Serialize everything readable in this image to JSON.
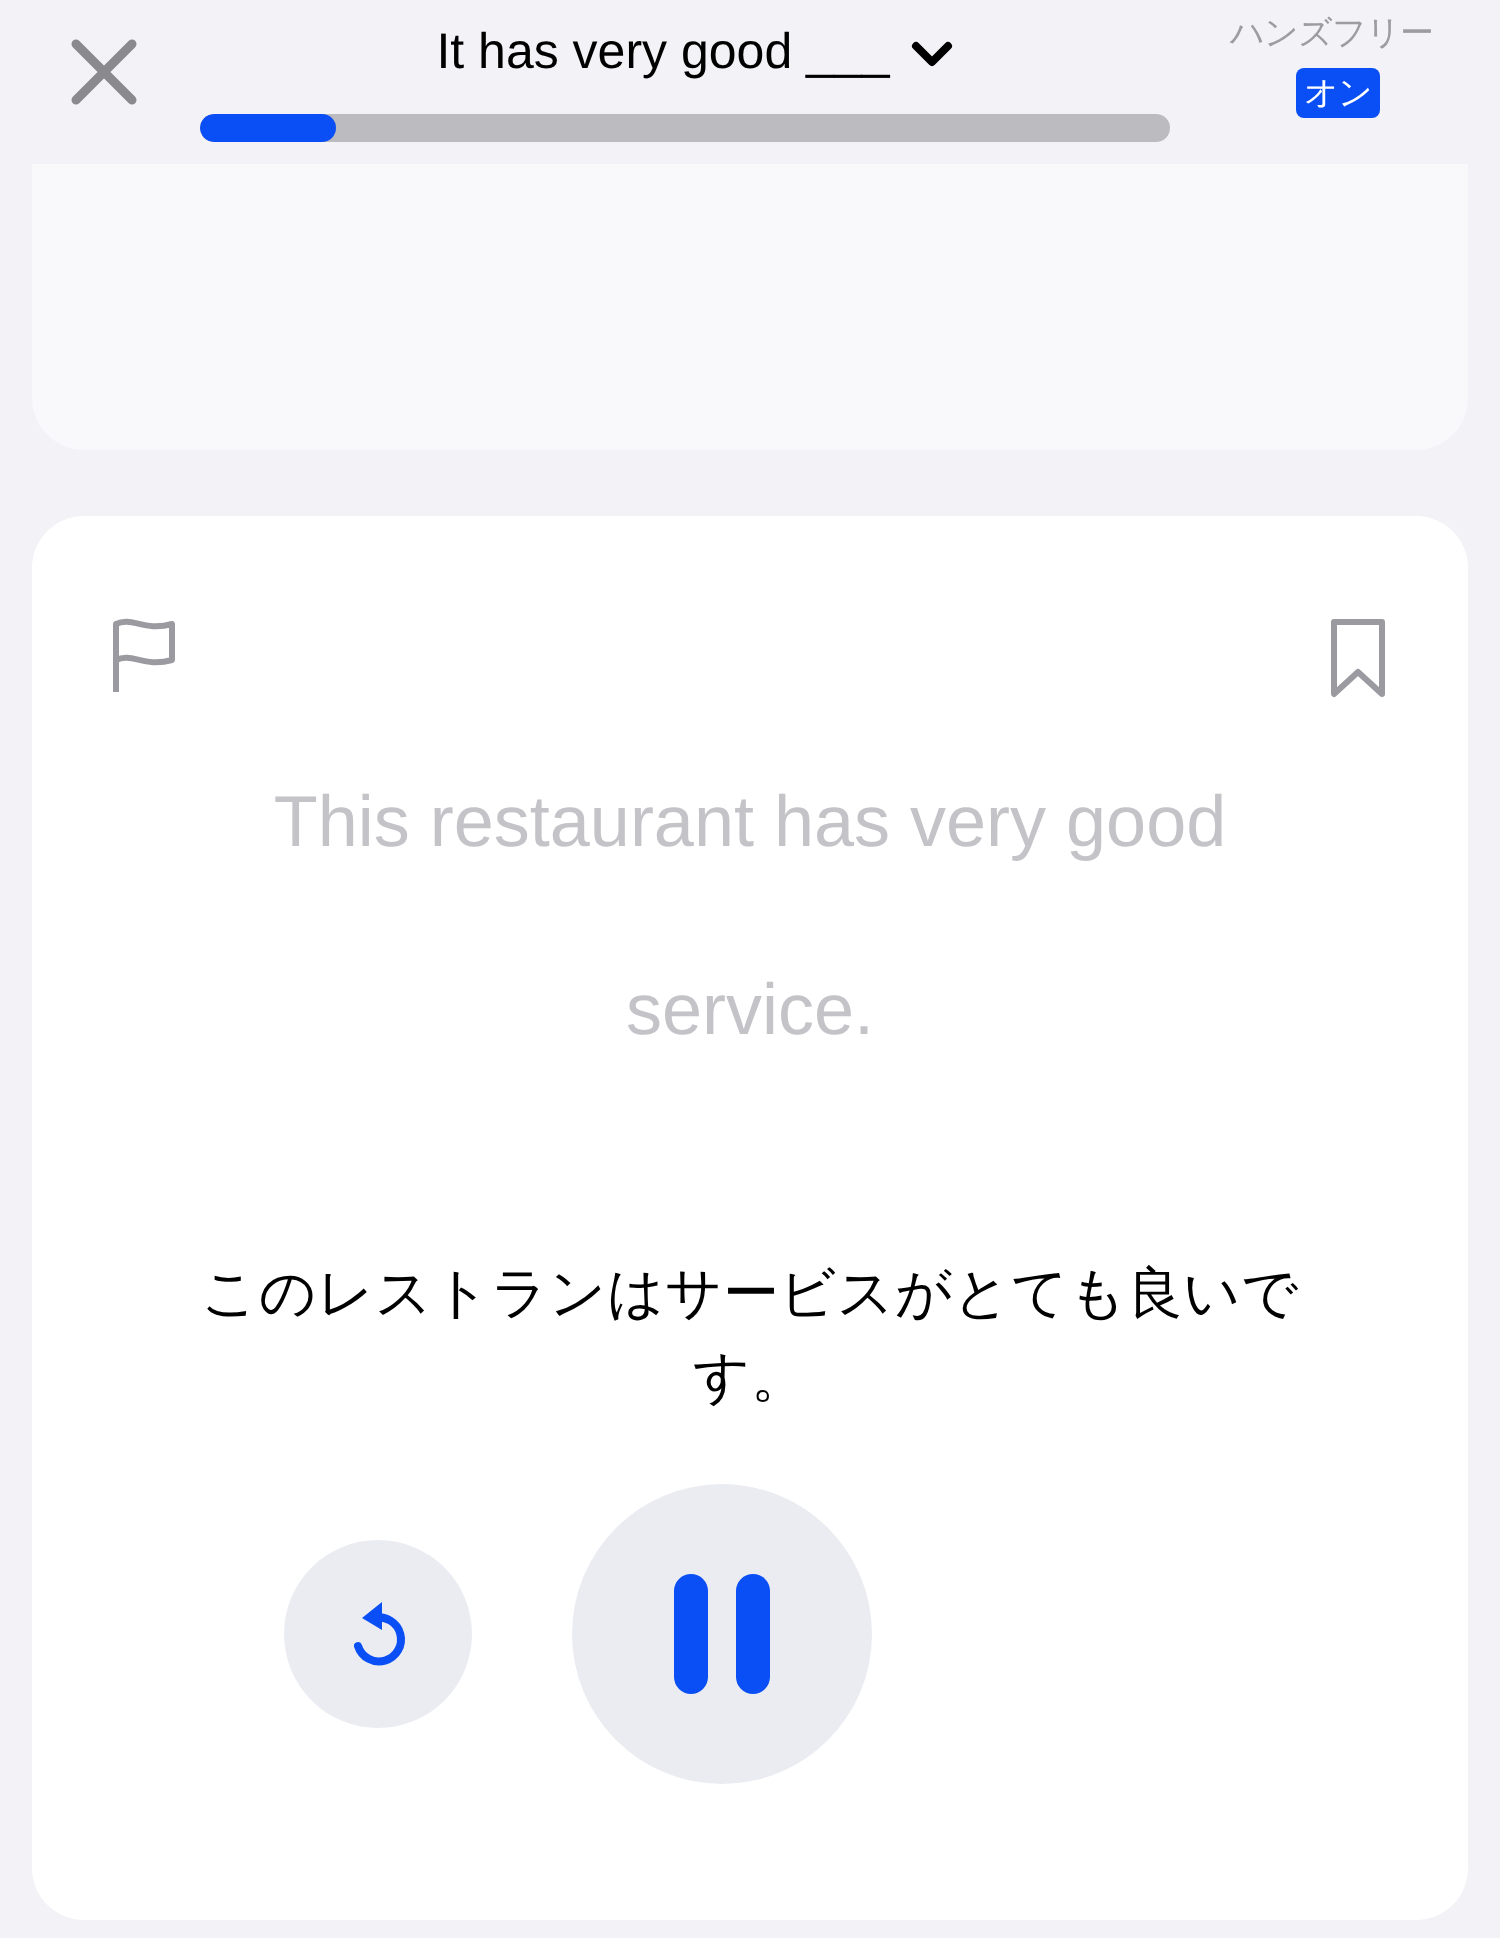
{
  "header": {
    "title": "It has very good ___",
    "progress": {
      "level": 0.14
    },
    "hands_free": {
      "label": "ハンズフリー",
      "status": "オン",
      "on": true
    }
  },
  "card": {
    "flagged": false,
    "bookmarked": false,
    "english": "This restaurant has very good service.",
    "japanese": "このレストランはサービスがとても良いです。",
    "playing": true
  }
}
